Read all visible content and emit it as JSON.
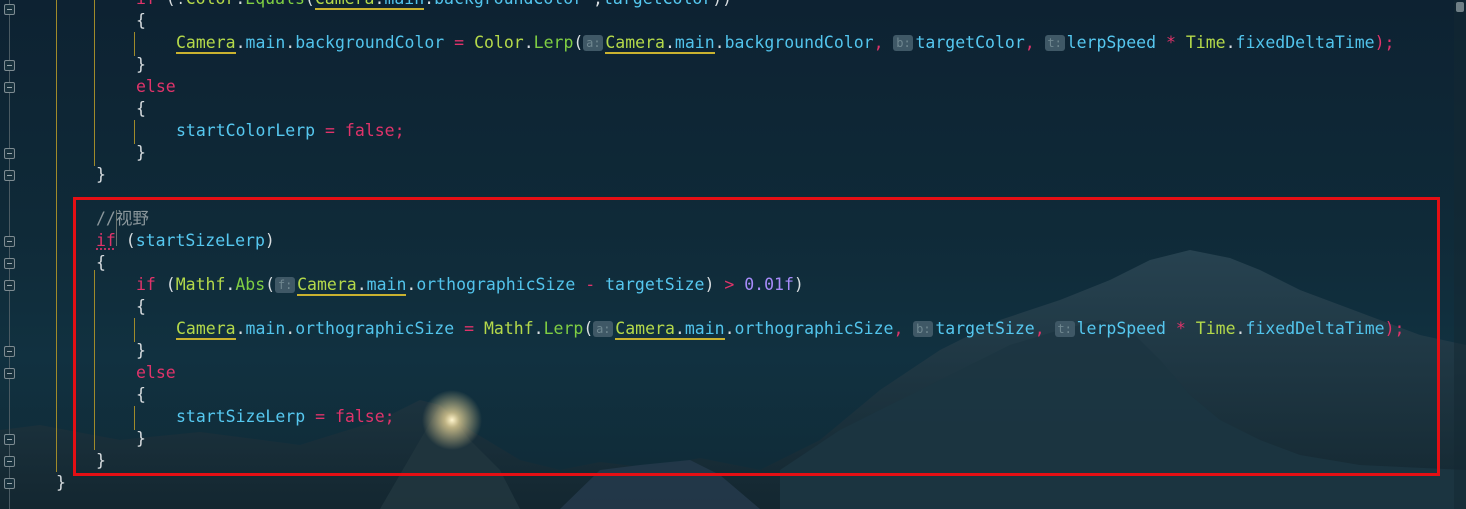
{
  "editor": {
    "theme_colors": {
      "keyword": "#e0336a",
      "type": "#7fce43",
      "member": "#52c4ec",
      "number": "#a78bfa",
      "comment": "#8b979c",
      "highlight_box": "#e50f14"
    },
    "hints": {
      "a": "a:",
      "b": "b:",
      "t": "t:",
      "f": "f:"
    }
  },
  "code": {
    "l0": {
      "if": "if",
      "rest_a": " (!",
      "color": "Color",
      "dot": ".",
      "equals": "Equals",
      "paren": "(",
      "camera": "Camera",
      "dot2": ".",
      "main": "main",
      "dot3": ".",
      "bg": "backgroundColor",
      "comma": " ,",
      "target": "targetColor",
      "close": "))"
    },
    "l1": {
      "brace": "{"
    },
    "l2": {
      "camera": "Camera",
      "dot": ".",
      "main": "main",
      "dot2": ".",
      "bg": "backgroundColor",
      "eq": " = ",
      "color": "Color",
      "dot3": ".",
      "lerp": "Lerp",
      "paren": "(",
      "camera2": "Camera",
      "dot4": ".",
      "main2": "main",
      "dot5": ".",
      "bg2": "backgroundColor",
      "comma1": ", ",
      "target": "targetColor",
      "comma2": ", ",
      "lerpSpeed": "lerpSpeed",
      "mul": " * ",
      "time": "Time",
      "dot6": ".",
      "fdt": "fixedDeltaTime",
      "end": ");"
    },
    "l3": {
      "brace": "}"
    },
    "l4": {
      "else": "else"
    },
    "l5": {
      "brace": "{"
    },
    "l6": {
      "var": "startColorLerp",
      "eq": " = ",
      "false": "false",
      "semi": ";"
    },
    "l7": {
      "brace": "}"
    },
    "l8": {
      "brace": "}"
    },
    "l9": {
      "comment": "//视野"
    },
    "l10": {
      "if": "if",
      "open": " (",
      "var": "startSizeLerp",
      "close": ")"
    },
    "l11": {
      "brace": "{"
    },
    "l12": {
      "if": "if",
      "open": " (",
      "mathf": "Mathf",
      "dot": ".",
      "abs": "Abs",
      "paren": "(",
      "camera": "Camera",
      "dot2": ".",
      "main": "main",
      "dot3": ".",
      "ortho": "orthographicSize",
      "minus": " - ",
      "target": "targetSize",
      "close": ")",
      "gt": " > ",
      "num": "0.01f",
      "end": ")"
    },
    "l13": {
      "brace": "{"
    },
    "l14": {
      "camera": "Camera",
      "dot": ".",
      "main": "main",
      "dot2": ".",
      "ortho": "orthographicSize",
      "eq": " = ",
      "mathf": "Mathf",
      "dot3": ".",
      "lerp": "Lerp",
      "paren": "(",
      "camera2": "Camera",
      "dot4": ".",
      "main2": "main",
      "dot5": ".",
      "ortho2": "orthographicSize",
      "comma1": ", ",
      "target": "targetSize",
      "comma2": ", ",
      "lerpSpeed": "lerpSpeed",
      "mul": " * ",
      "time": "Time",
      "dot6": ".",
      "fdt": "fixedDeltaTime",
      "end": ");"
    },
    "l15": {
      "brace": "}"
    },
    "l16": {
      "else": "else"
    },
    "l17": {
      "brace": "{"
    },
    "l18": {
      "var": "startSizeLerp",
      "eq": " = ",
      "false": "false",
      "semi": ";"
    },
    "l19": {
      "brace": "}"
    },
    "l20": {
      "brace": "}"
    },
    "l21": {
      "brace": "}"
    }
  }
}
